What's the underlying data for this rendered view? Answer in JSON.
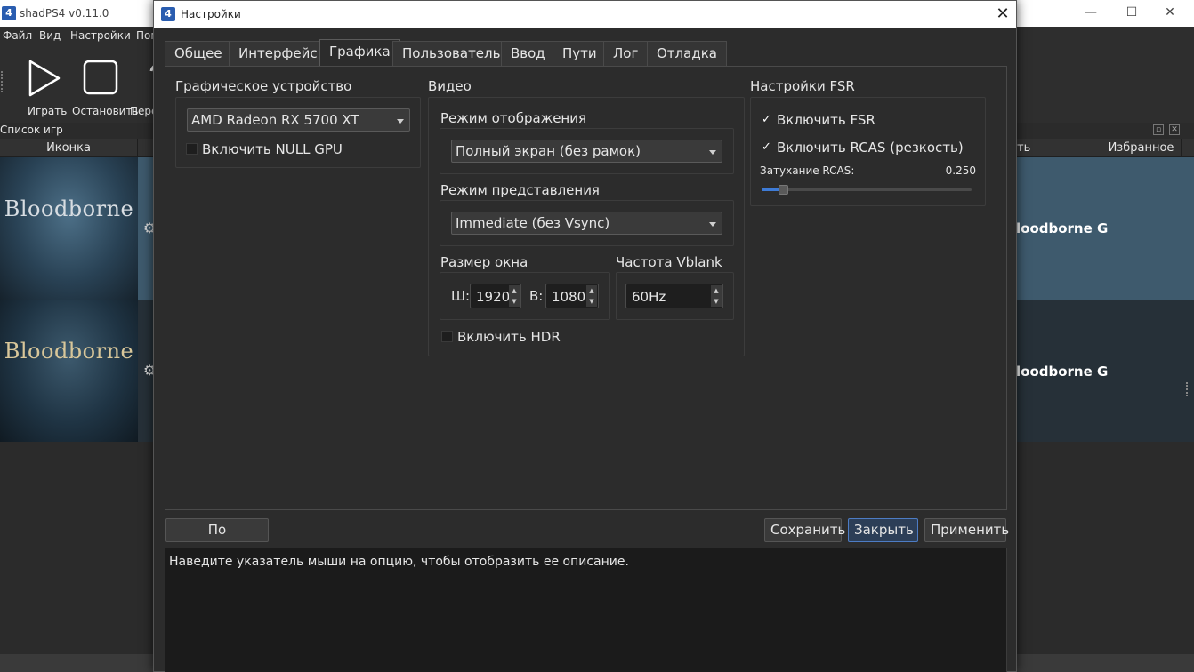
{
  "main_window": {
    "title": "shadPS4 v0.11.0",
    "icon_text": "4",
    "menu": [
      "Файл",
      "Вид",
      "Настройки",
      "Пом"
    ],
    "toolbar": {
      "play_label": "Играть",
      "stop_label": "Остановить",
      "restart_label": "Пере"
    },
    "game_list_caption": "Список игр",
    "columns": {
      "icon": "Иконка",
      "name_partial": "ть",
      "favorite": "Избранное"
    },
    "games": [
      {
        "logo_text": "Bloodborne",
        "name_visible": "loodborne G"
      },
      {
        "logo_text": "Bloodborne",
        "name_visible": "loodborne G"
      }
    ]
  },
  "dialog": {
    "title": "Настройки",
    "icon_text": "4",
    "tabs": [
      "Общее",
      "Интерфейс",
      "Графика",
      "Пользователь",
      "Ввод",
      "Пути",
      "Лог",
      "Отладка"
    ],
    "active_tab": "Графика",
    "graphics_device": {
      "title": "Графическое устройство",
      "device_value": "AMD Radeon RX 5700 XT",
      "null_gpu_label": "Включить NULL GPU",
      "null_gpu_checked": false
    },
    "video": {
      "title": "Видео",
      "display_mode_label": "Режим отображения",
      "display_mode_value": "Полный экран (без рамок)",
      "present_mode_label": "Режим представления",
      "present_mode_value": "Immediate (без Vsync)",
      "window_size_label": "Размер окна",
      "width_prefix": "Ш:",
      "width_value": "1920",
      "height_prefix": "В:",
      "height_value": "1080",
      "vblank_label": "Частота Vblank",
      "vblank_value": "60Hz",
      "hdr_label": "Включить HDR",
      "hdr_checked": false
    },
    "fsr": {
      "title": "Настройки FSR",
      "enable_fsr_label": "Включить FSR",
      "enable_fsr_checked": true,
      "enable_rcas_label": "Включить RCAS (резкость)",
      "enable_rcas_checked": true,
      "rcas_attenuation_label": "Затухание RCAS:",
      "rcas_attenuation_value": "0.250",
      "rcas_slider_fraction": 0.1
    },
    "buttons": {
      "defaults": "По умолчанию",
      "save": "Сохранить",
      "close": "Закрыть",
      "apply": "Применить"
    },
    "description_text": "Наведите указатель мыши на опцию, чтобы отобразить ее описание."
  },
  "colors": {
    "accent": "#3e7bd6",
    "dialog_bg": "#2c2c2c",
    "titlebar_bg": "#ffffff"
  }
}
